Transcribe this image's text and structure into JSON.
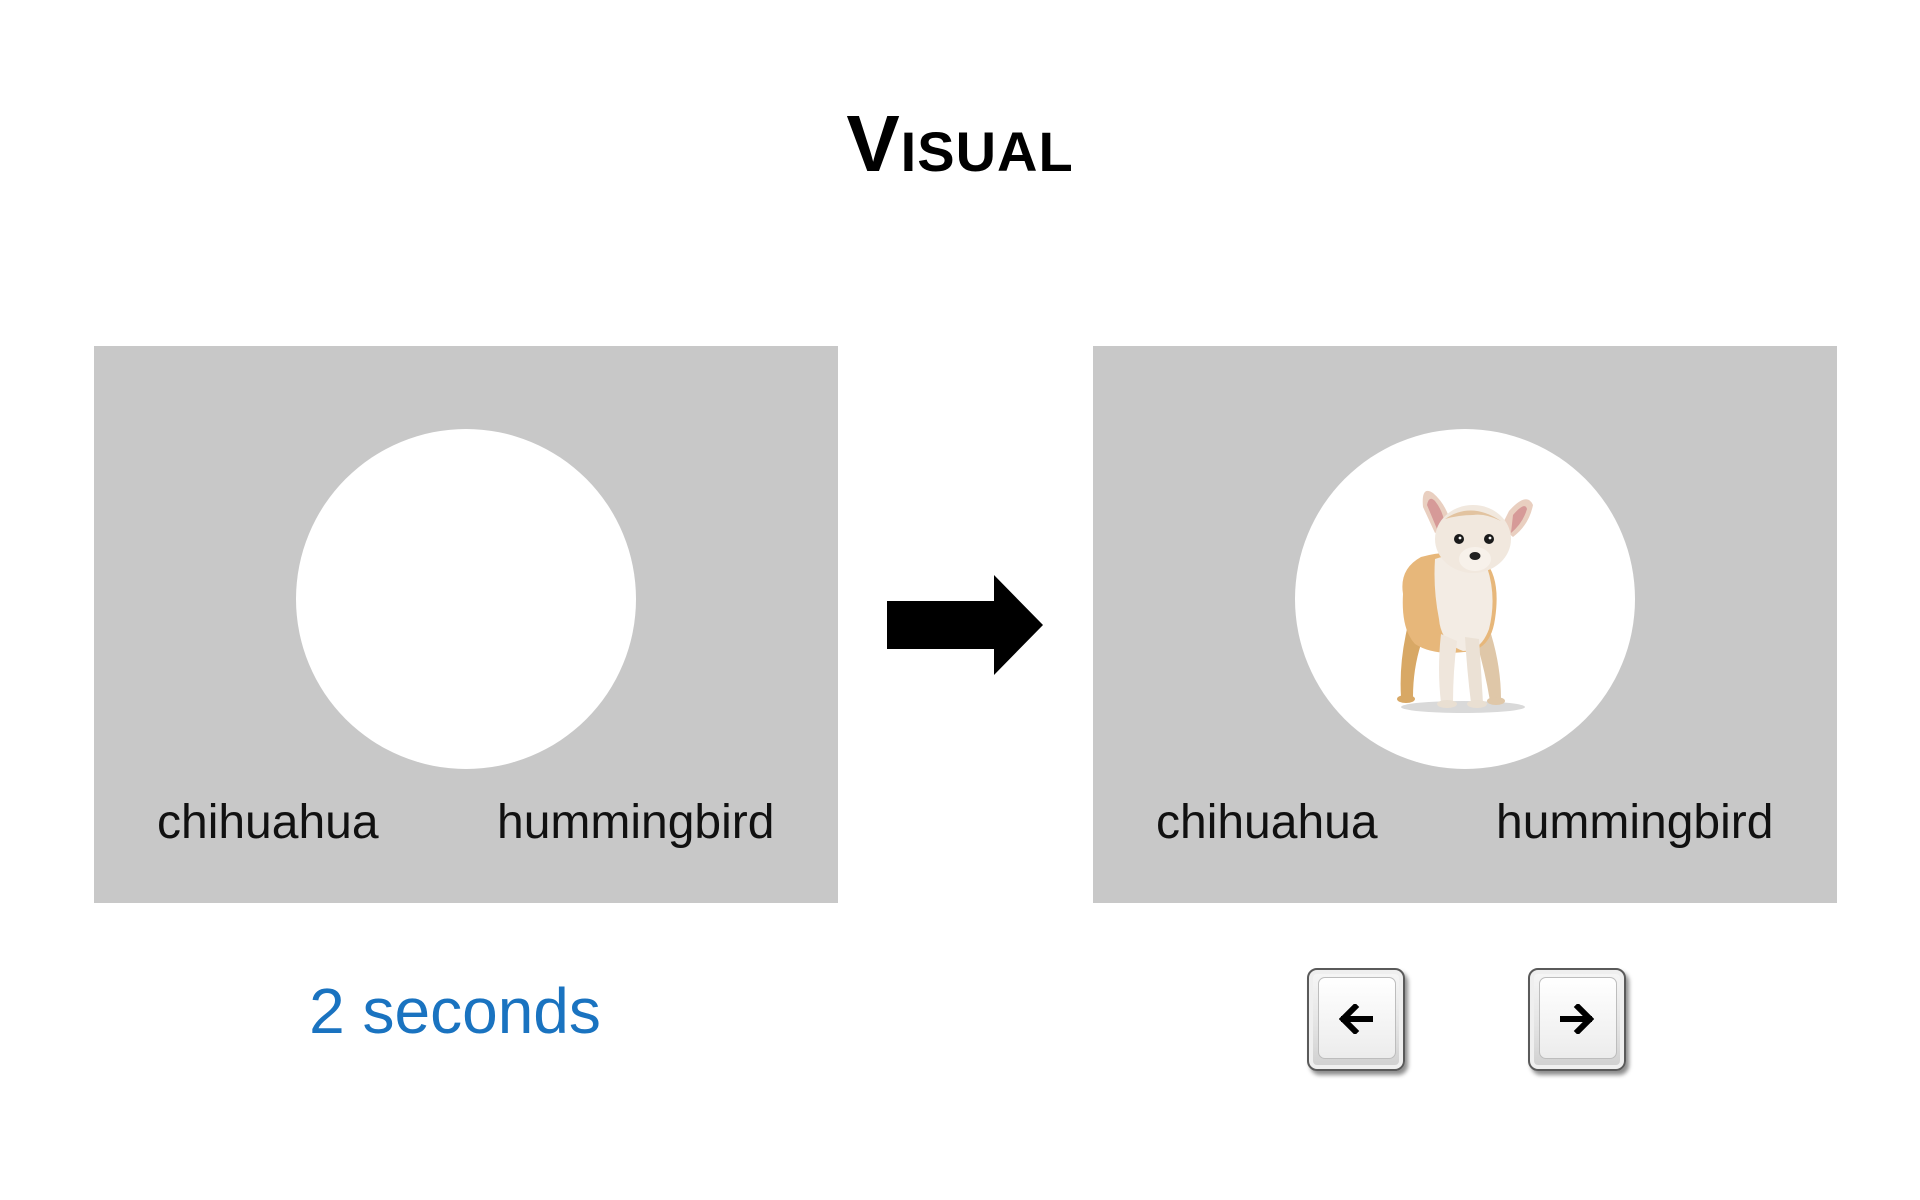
{
  "title": "Visual",
  "left_panel": {
    "choices": [
      "chihuahua",
      "hummingbird"
    ],
    "circle_content": "empty"
  },
  "right_panel": {
    "choices": [
      "chihuahua",
      "hummingbird"
    ],
    "circle_content": "chihuahua-image"
  },
  "duration_label": "2 seconds",
  "colors": {
    "panel_background": "#c8c8c8",
    "circle": "#ffffff",
    "duration_text": "#1a73c0"
  },
  "icons": {
    "flow_arrow": "right-arrow-icon",
    "key_left": "left-arrow-key-icon",
    "key_right": "right-arrow-key-icon"
  }
}
